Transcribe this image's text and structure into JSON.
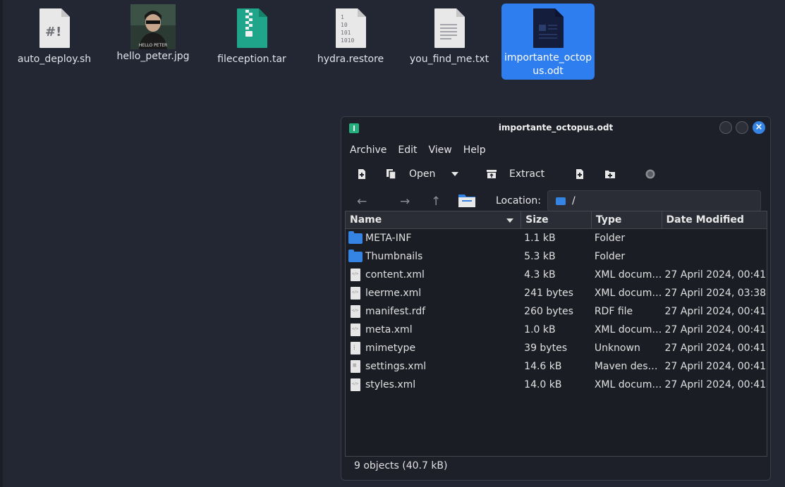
{
  "desktop": {
    "icons": [
      {
        "label": "auto_deploy.sh",
        "icon": "shell-script-icon"
      },
      {
        "label": "hello_peter.jpg",
        "icon": "image-thumbnail-icon",
        "thumb_text": "HELLO PETER"
      },
      {
        "label": "fileception.tar",
        "icon": "archive-icon"
      },
      {
        "label": "hydra.restore",
        "icon": "binary-file-icon"
      },
      {
        "label": "you_find_me.txt",
        "icon": "text-file-icon"
      },
      {
        "label": "importante_octopus.odt",
        "icon": "document-icon"
      }
    ]
  },
  "window": {
    "title": "importante_octopus.odt",
    "menu": [
      "Archive",
      "Edit",
      "View",
      "Help"
    ],
    "toolbar": {
      "open_label": "Open",
      "extract_label": "Extract"
    },
    "location_label": "Location:",
    "location_value": "/",
    "columns": [
      "Name",
      "Size",
      "Type",
      "Date Modified"
    ],
    "files": [
      {
        "name": "META-INF",
        "size": "1.1 kB",
        "type": "Folder",
        "date": "",
        "kind": "folder"
      },
      {
        "name": "Thumbnails",
        "size": "5.3 kB",
        "type": "Folder",
        "date": "",
        "kind": "folder"
      },
      {
        "name": "content.xml",
        "size": "4.3 kB",
        "type": "XML docum…",
        "date": "27 April 2024, 00:41",
        "kind": "xml"
      },
      {
        "name": "leerme.xml",
        "size": "241 bytes",
        "type": "XML docum…",
        "date": "27 April 2024, 03:38",
        "kind": "xml"
      },
      {
        "name": "manifest.rdf",
        "size": "260 bytes",
        "type": "RDF file",
        "date": "27 April 2024, 00:41",
        "kind": "xml"
      },
      {
        "name": "meta.xml",
        "size": "1.0 kB",
        "type": "XML docum…",
        "date": "27 April 2024, 00:41",
        "kind": "xml"
      },
      {
        "name": "mimetype",
        "size": "39 bytes",
        "type": "Unknown",
        "date": "27 April 2024, 00:41",
        "kind": "bin"
      },
      {
        "name": "settings.xml",
        "size": "14.6 kB",
        "type": "Maven desc…",
        "date": "27 April 2024, 00:41",
        "kind": "plain"
      },
      {
        "name": "styles.xml",
        "size": "14.0 kB",
        "type": "XML docum…",
        "date": "27 April 2024, 00:41",
        "kind": "xml"
      }
    ],
    "status": "9 objects (40.7 kB)"
  },
  "colors": {
    "desktop_bg": "#232733",
    "accent": "#3584e4",
    "selection": "#2f7ef0"
  }
}
